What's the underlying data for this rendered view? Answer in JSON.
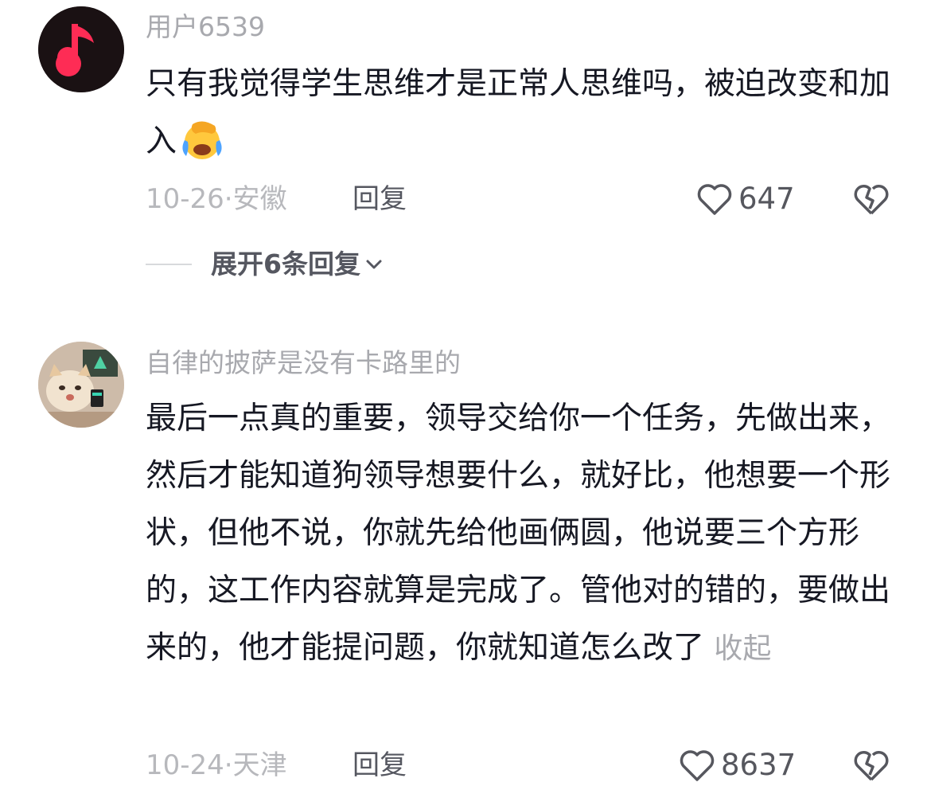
{
  "comments": [
    {
      "username": "用户6539",
      "text": "只有我觉得学生思维才是正常人思维吗，被迫改变和加入",
      "emoji": "face-palm-crying-icon",
      "date_location": "10-26·安徽",
      "reply_label": "回复",
      "likes": "647",
      "expand_label": "展开6条回复"
    },
    {
      "username": "自律的披萨是没有卡路里的",
      "text": "最后一点真的重要，领导交给你一个任务，先做出来，然后才能知道狗领导想要什么，就好比，他想要一个形状，但他不说，你就先给他画俩圆，他说要三个方形的，这工作内容就算是完成了。管他对的错的，要做出来的，他才能提问题，你就知道怎么改了",
      "collapse_label": "收起",
      "date_location": "10-24·天津",
      "reply_label": "回复",
      "likes": "8637"
    }
  ],
  "colors": {
    "primary_text": "#161823",
    "secondary_text": "#a8a9ae",
    "music_red": "#fe2c55"
  }
}
